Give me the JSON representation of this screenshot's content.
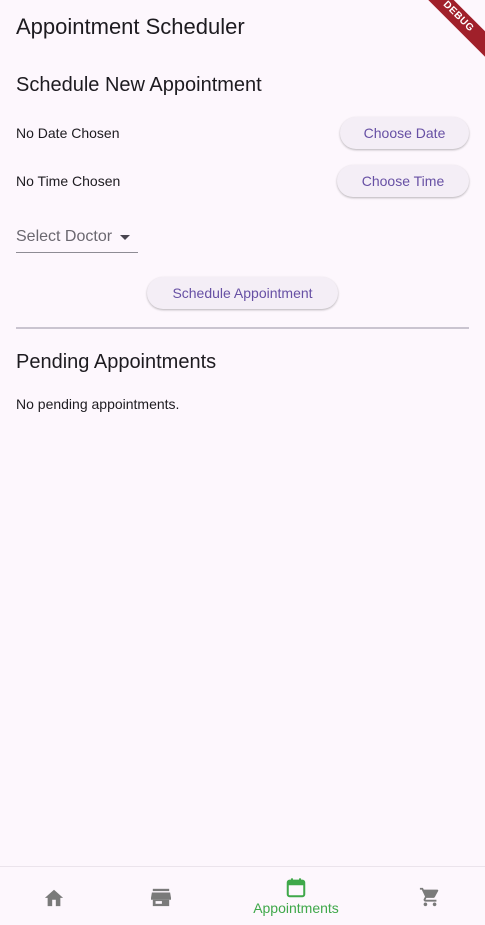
{
  "app": {
    "title": "Appointment Scheduler",
    "debug_banner": "DEBUG"
  },
  "schedule": {
    "heading": "Schedule New Appointment",
    "date_status": "No Date Chosen",
    "choose_date_label": "Choose Date",
    "time_status": "No Time Chosen",
    "choose_time_label": "Choose Time",
    "doctor_dropdown": {
      "selected": "Select Doctor"
    },
    "submit_label": "Schedule Appointment"
  },
  "pending": {
    "heading": "Pending Appointments",
    "empty_message": "No pending appointments."
  },
  "bottom_nav": {
    "items": [
      {
        "icon": "home-icon",
        "label": "",
        "active": false
      },
      {
        "icon": "store-icon",
        "label": "",
        "active": false
      },
      {
        "icon": "calendar-icon",
        "label": "Appointments",
        "active": true
      },
      {
        "icon": "cart-icon",
        "label": "",
        "active": false
      }
    ],
    "active_color": "#3fa84a",
    "inactive_color": "#7a7a7a"
  },
  "colors": {
    "background": "#fdf7fd",
    "button_text": "#6750a4",
    "debug_banner": "#a0202a"
  }
}
